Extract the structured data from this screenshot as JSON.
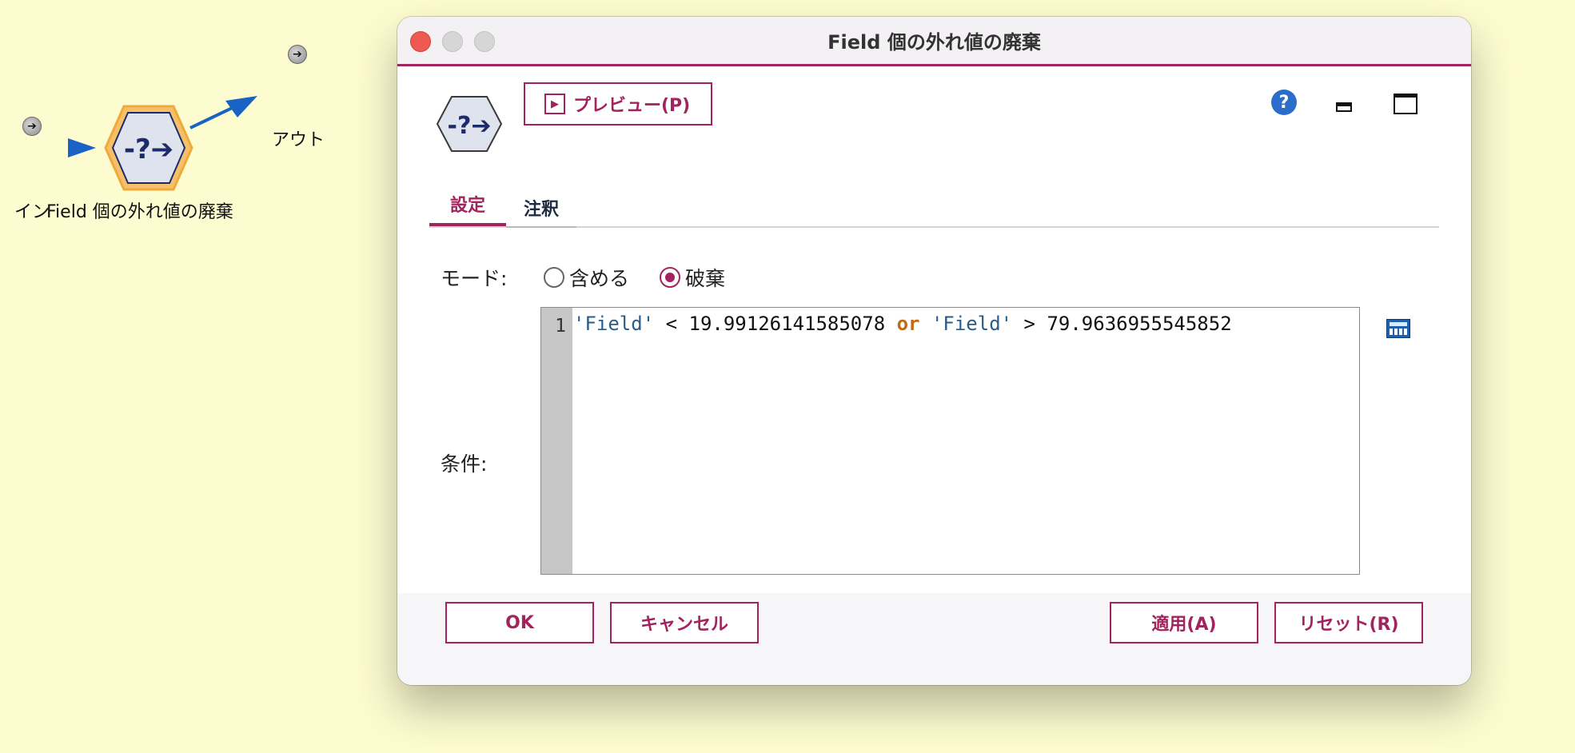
{
  "canvas": {
    "in_label": "イン",
    "node_label": "Field 個の外れ値の廃棄",
    "out_label": "アウト"
  },
  "dialog": {
    "title": "Field 個の外れ値の廃棄",
    "preview_label": "プレビュー(P)",
    "help_glyph": "?",
    "tabs": [
      {
        "label": "設定",
        "active": true
      },
      {
        "label": "注釈",
        "active": false
      }
    ],
    "mode": {
      "label": "モード:",
      "options": [
        "含める",
        "破棄"
      ],
      "selected": "破棄"
    },
    "condition": {
      "label": "条件:",
      "line_number": "1",
      "tokens": {
        "field1": "'Field'",
        "op1": " < 19.99126141585078 ",
        "kw": "or",
        "sp": " ",
        "field2": "'Field'",
        "op2": " > 79.9636955545852"
      }
    },
    "buttons": {
      "ok": "OK",
      "cancel": "キャンセル",
      "apply": "適用(A)",
      "reset": "リセット(R)"
    },
    "accent_color": "#a3235f",
    "icons": [
      "play-icon",
      "help-icon",
      "minimize-icon",
      "maximize-icon",
      "expression-builder-icon"
    ]
  }
}
